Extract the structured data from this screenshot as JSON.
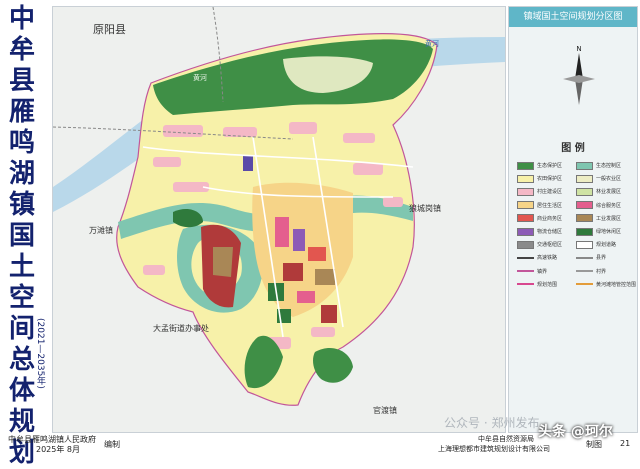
{
  "title": {
    "chars": [
      "中",
      "牟",
      "县",
      "雁",
      "鸣",
      "湖",
      "镇",
      "国",
      "土",
      "空",
      "间",
      "总",
      "体",
      "规",
      "划"
    ],
    "years": "(2021—2035年)"
  },
  "map": {
    "labels": {
      "north_county": "原阳县",
      "river_right": "黄河",
      "river_left": "黄河",
      "east_town": "狼城岗镇",
      "west_town": "万滩镇",
      "southwest_office": "大孟街道办事处",
      "south_town": "官渡镇"
    },
    "colors": {
      "background": "#eef0ee",
      "ecological": "#3f8f46",
      "farmland_protect": "#f7f1a9",
      "water": "#7fc6b0",
      "river": "#b9d8ea",
      "village": "#f4b8c6",
      "urban": "#f6d488"
    }
  },
  "panel": {
    "header": "镇域国土空间规划分区图",
    "compass_north": "N",
    "legend_title": "图  例",
    "legend": [
      {
        "label": "生态保护区",
        "color": "#3f8f46",
        "type": "fill"
      },
      {
        "label": "生态控制区",
        "color": "#7fc6b0",
        "type": "fill"
      },
      {
        "label": "农田保护区",
        "color": "#f7f1a9",
        "type": "fill"
      },
      {
        "label": "一般农业区",
        "color": "#ededc4",
        "type": "fill"
      },
      {
        "label": "村庄建设区",
        "color": "#f4b8c6",
        "type": "fill"
      },
      {
        "label": "林业发展区",
        "color": "#cfe3a4",
        "type": "fill"
      },
      {
        "label": "居住生活区",
        "color": "#f6d488",
        "type": "fill"
      },
      {
        "label": "综合服务区",
        "color": "#e45f8e",
        "type": "fill"
      },
      {
        "label": "商业商务区",
        "color": "#e2564f",
        "type": "fill"
      },
      {
        "label": "工业发展区",
        "color": "#a98756",
        "type": "fill"
      },
      {
        "label": "物流仓储区",
        "color": "#8d5bb6",
        "type": "fill"
      },
      {
        "label": "绿地休闲区",
        "color": "#2f7a3c",
        "type": "fill"
      },
      {
        "label": "交通枢纽区",
        "color": "#8a8a8a",
        "type": "fill"
      },
      {
        "label": "规划道路",
        "color": "#ffffff",
        "type": "fill"
      },
      {
        "label": "高速铁路",
        "color": "#444444",
        "type": "line"
      },
      {
        "label": "县界",
        "color": "#888888",
        "type": "line"
      },
      {
        "label": "镇界",
        "color": "#c2569a",
        "type": "line"
      },
      {
        "label": "村界",
        "color": "#999999",
        "type": "line"
      },
      {
        "label": "规划范围",
        "color": "#d8478f",
        "type": "line"
      },
      {
        "label": "黄河滩地管控范围",
        "color": "#e39c3a",
        "type": "line"
      }
    ]
  },
  "footer": {
    "gov_line1": "中牟县雁鸣湖镇人民政府",
    "gov_line2": "2025年 8月",
    "bianzhi": "编制",
    "org_line1": "中牟县自然资源局",
    "org_line2": "上海理想都市建筑规划设计有限公司",
    "zhitu": "制图",
    "page": "21"
  },
  "watermark": {
    "text1": "公众号 · 郑州发布",
    "text2": "头条 @珂尔"
  }
}
